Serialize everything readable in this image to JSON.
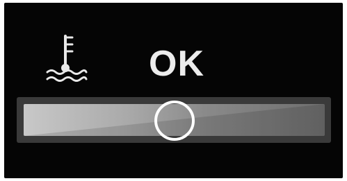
{
  "status": {
    "label": "OK"
  },
  "icon": {
    "name": "coolant-temperature-icon",
    "color": "#e8e8e8"
  },
  "gauge": {
    "level": 0.5,
    "track_colors": [
      "#c8c8c8",
      "#6e6e6e"
    ],
    "knob_color": "#ffffff"
  },
  "theme": {
    "background": "#050505",
    "text": "#ececec"
  }
}
